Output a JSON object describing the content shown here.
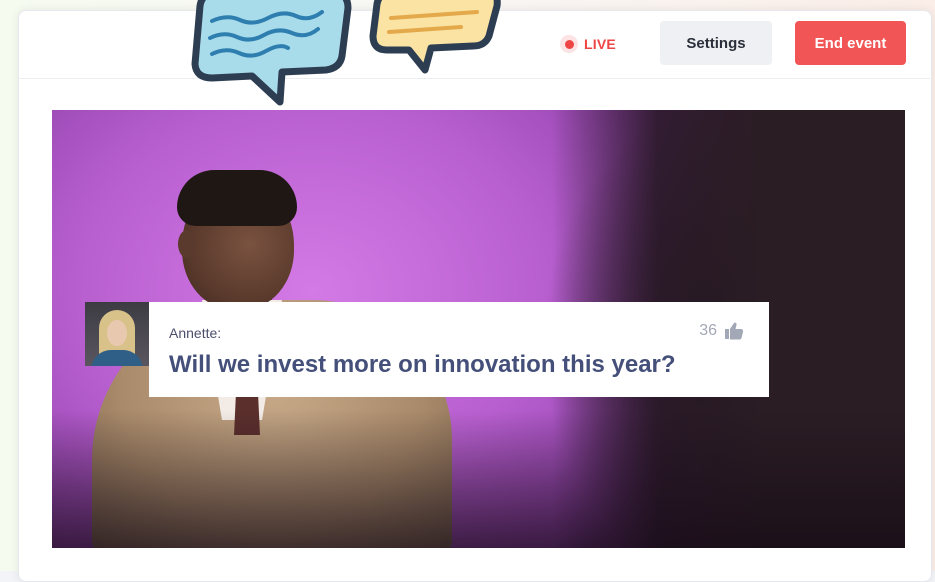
{
  "header": {
    "live_label": "LIVE",
    "settings_label": "Settings",
    "end_event_label": "End event"
  },
  "question": {
    "author": "Annette:",
    "text": "Will we invest more on innovation this year?",
    "likes": "36"
  },
  "icons": {
    "live": "record-dot-icon",
    "likes": "thumbs-up-icon",
    "decoration_left": "chat-bubble-icon",
    "decoration_right": "chat-bubble-icon"
  },
  "colors": {
    "live": "#ef4444",
    "end_event": "#f25555",
    "settings_bg": "#eef0f3",
    "question_text": "#45507a",
    "stage_accent": "#c76fdd"
  }
}
